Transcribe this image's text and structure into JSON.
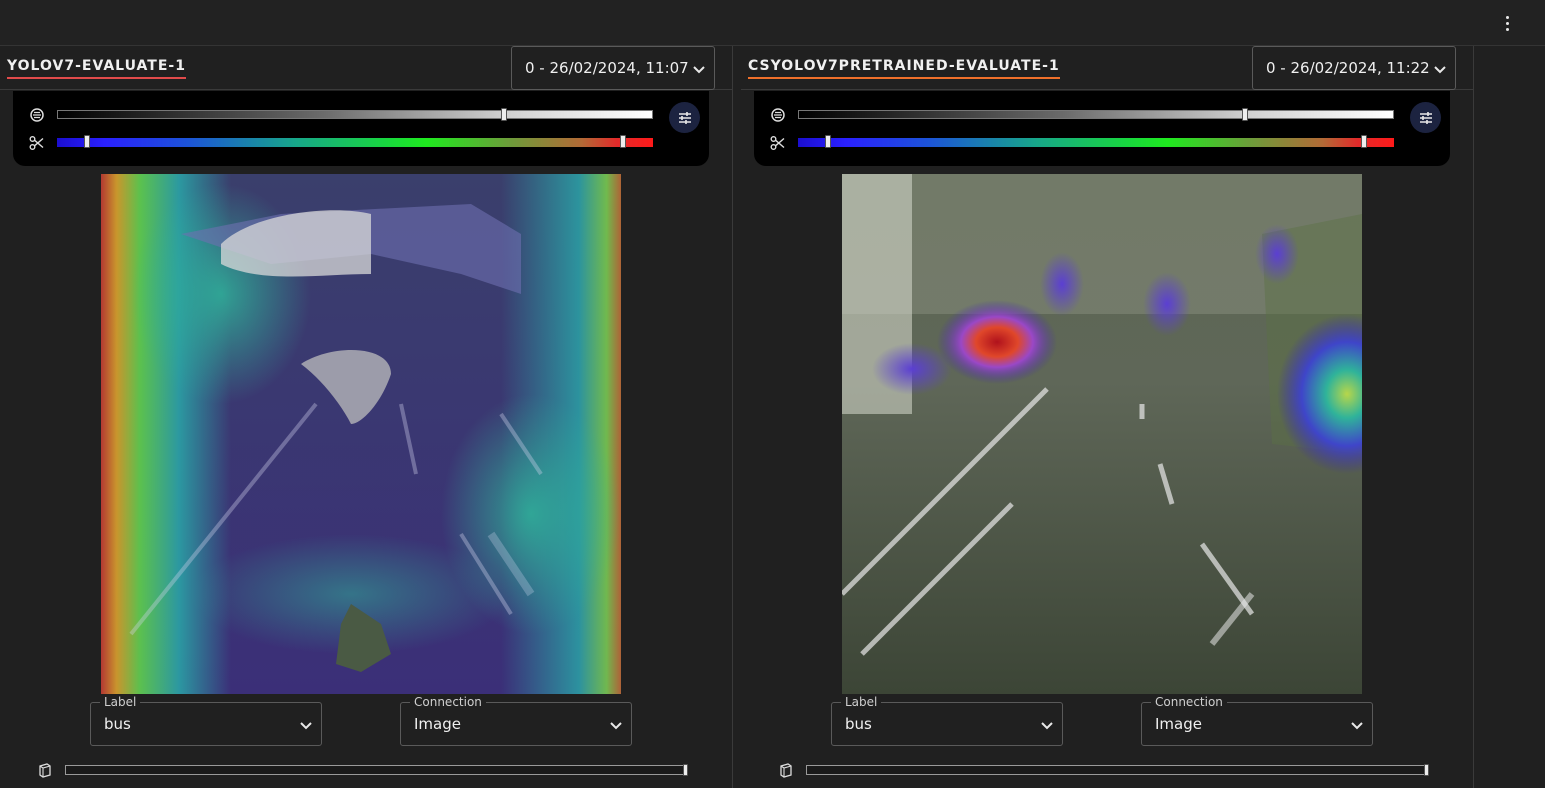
{
  "app": {
    "menu_icon": "more-vertical-icon"
  },
  "panels": [
    {
      "title": "YOLOV7-EVALUATE-1",
      "accent": "#e14b4b",
      "run_select": {
        "value": "0 - 26/02/2024, 11:07"
      },
      "controls": {
        "opacity_icon": "opacity-icon",
        "clip_icon": "scissors-icon",
        "settings_icon": "tune-icon",
        "opacity_value": 0.75,
        "clip_range": [
          0.05,
          0.95
        ]
      },
      "label_field": {
        "legend": "Label",
        "value": "bus"
      },
      "connection_field": {
        "legend": "Connection",
        "value": "Image"
      },
      "bottom_slider": {
        "icon": "stack-icon",
        "value": 1.0
      }
    },
    {
      "title": "CSYOLOV7PRETRAINED-EVALUATE-1",
      "accent": "#f0702a",
      "run_select": {
        "value": "0 - 26/02/2024, 11:22"
      },
      "controls": {
        "opacity_icon": "opacity-icon",
        "clip_icon": "scissors-icon",
        "settings_icon": "tune-icon",
        "opacity_value": 0.75,
        "clip_range": [
          0.05,
          0.95
        ]
      },
      "label_field": {
        "legend": "Label",
        "value": "bus"
      },
      "connection_field": {
        "legend": "Connection",
        "value": "Image"
      },
      "bottom_slider": {
        "icon": "stack-icon",
        "value": 1.0
      }
    }
  ]
}
